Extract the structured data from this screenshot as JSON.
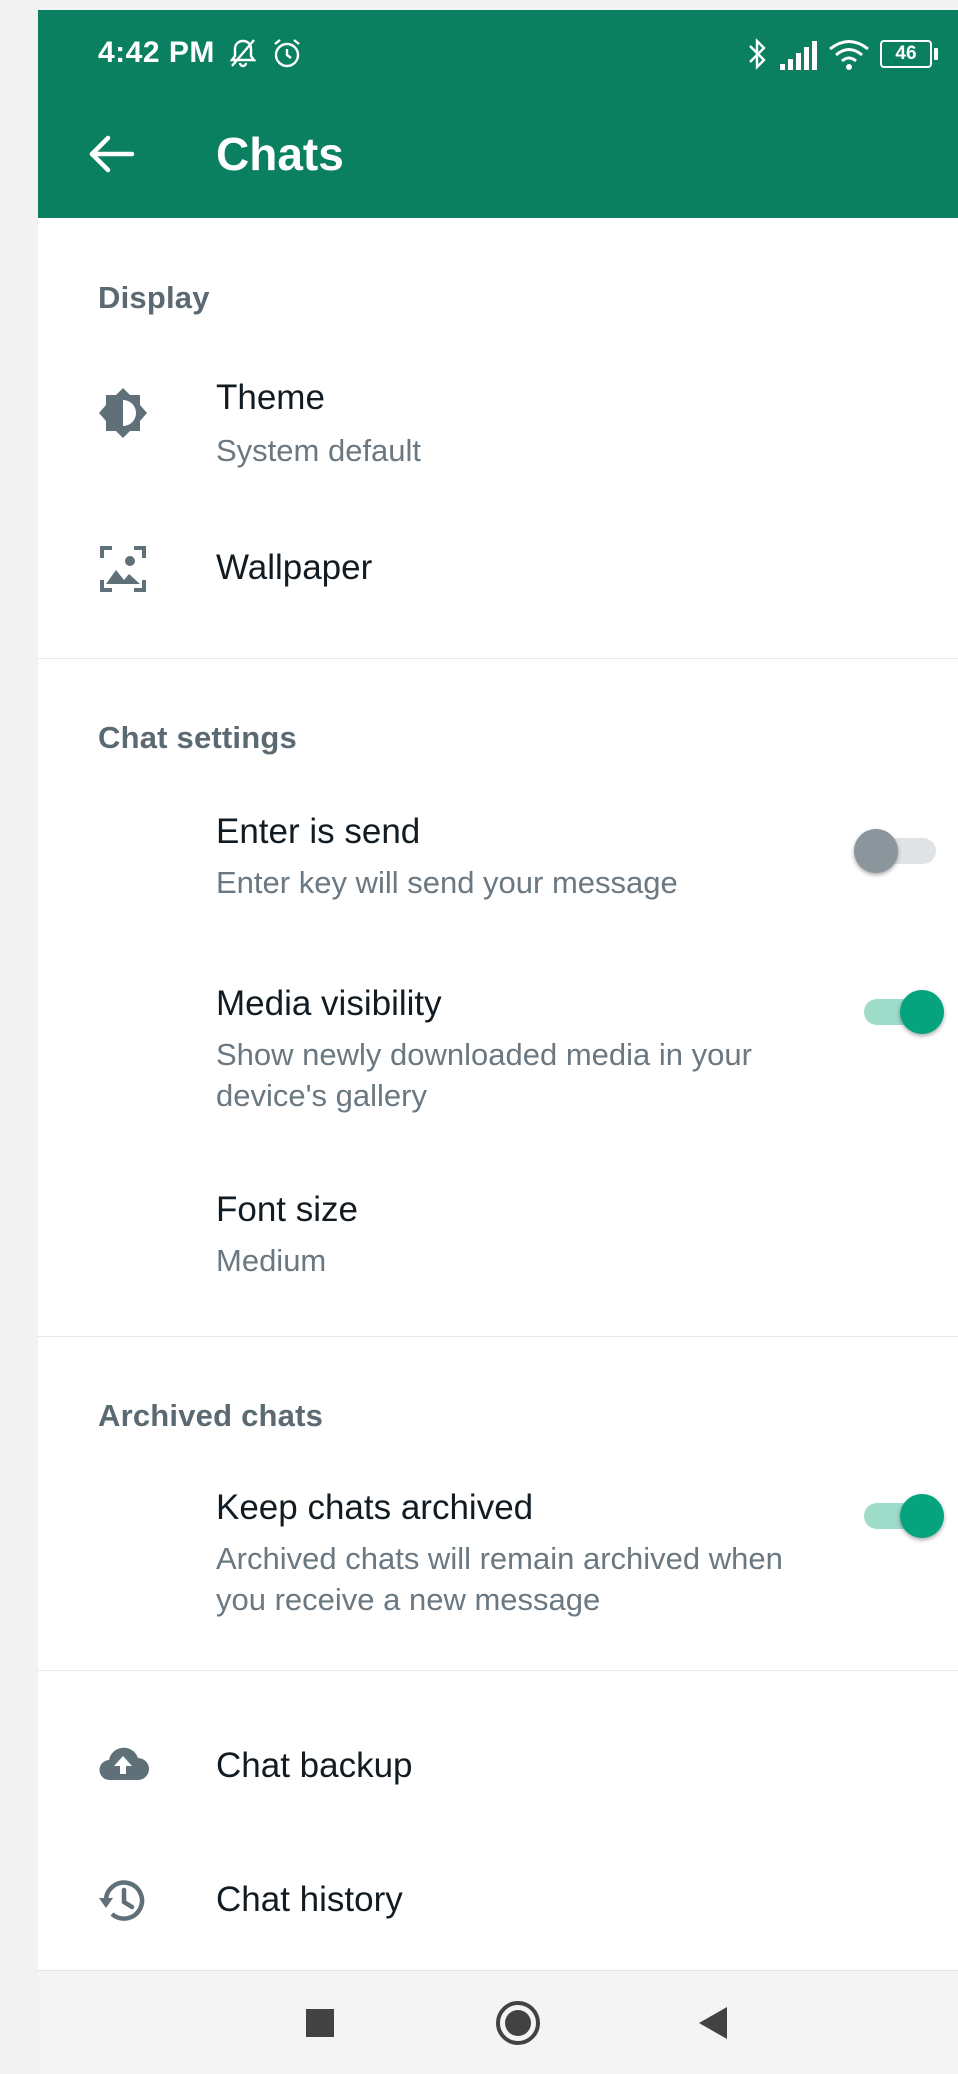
{
  "status_bar": {
    "time": "4:42 PM",
    "battery": "46"
  },
  "app_bar": {
    "title": "Chats"
  },
  "sections": {
    "display": {
      "header": "Display",
      "theme": {
        "title": "Theme",
        "subtitle": "System default",
        "icon": "theme-icon"
      },
      "wallpaper": {
        "title": "Wallpaper",
        "icon": "wallpaper-icon"
      }
    },
    "chat_settings": {
      "header": "Chat settings",
      "enter_is_send": {
        "title": "Enter is send",
        "subtitle": "Enter key will send your message",
        "enabled": false
      },
      "media_visibility": {
        "title": "Media visibility",
        "subtitle": "Show newly downloaded media in your device's gallery",
        "enabled": true
      },
      "font_size": {
        "title": "Font size",
        "subtitle": "Medium"
      }
    },
    "archived_chats": {
      "header": "Archived chats",
      "keep_archived": {
        "title": "Keep chats archived",
        "subtitle": "Archived chats will remain archived when you receive a new message",
        "enabled": true
      }
    },
    "other": {
      "backup": {
        "title": "Chat backup",
        "icon": "cloud-upload-icon"
      },
      "history": {
        "title": "Chat history",
        "icon": "history-icon"
      }
    }
  },
  "colors": {
    "app_bar": "#0a8060",
    "toggle_on": "#05a37e",
    "toggle_off": "#8a959c"
  }
}
